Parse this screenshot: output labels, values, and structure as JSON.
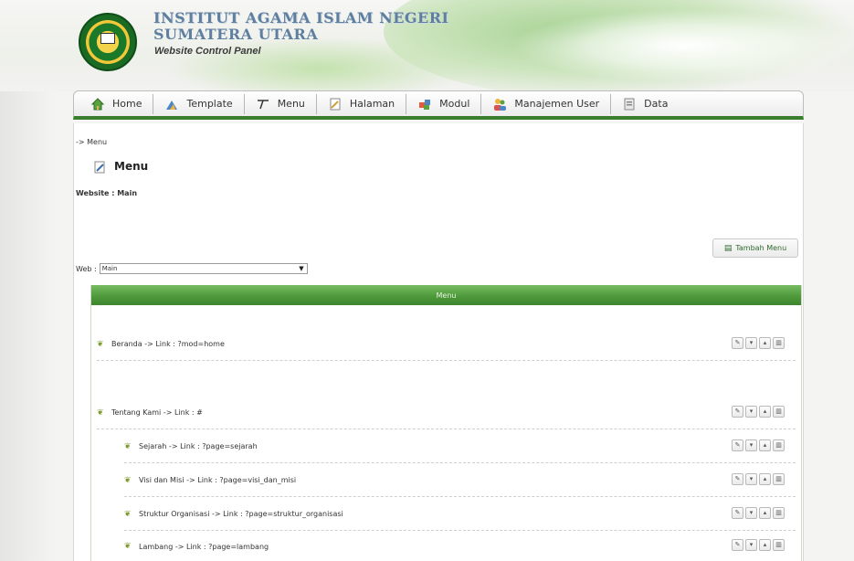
{
  "header": {
    "institution_line1": "INSTITUT AGAMA ISLAM NEGERI",
    "institution_line2": "SUMATERA UTARA",
    "panel_title": "Website Control Panel"
  },
  "nav": {
    "items": [
      {
        "label": "Home",
        "icon": "home-icon"
      },
      {
        "label": "Template",
        "icon": "template-icon"
      },
      {
        "label": "Menu",
        "icon": "menu-icon"
      },
      {
        "label": "Halaman",
        "icon": "page-icon"
      },
      {
        "label": "Modul",
        "icon": "module-icon"
      },
      {
        "label": "Manajemen User",
        "icon": "users-icon"
      },
      {
        "label": "Data",
        "icon": "data-icon"
      }
    ]
  },
  "content": {
    "breadcrumb": "-> Menu",
    "page_title": "Menu",
    "website_label": "Website : Main",
    "add_button_label": "Tambah Menu",
    "web_select_label": "Web :",
    "web_select_value": "Main",
    "table_header": "Menu",
    "rows": [
      {
        "text": "Beranda -> Link : ?mod=home",
        "level": 0
      },
      {
        "text": "Tentang Kami -> Link : #",
        "level": 0
      },
      {
        "text": "Sejarah -> Link : ?page=sejarah",
        "level": 1
      },
      {
        "text": "Visi dan Misi -> Link : ?page=visi_dan_misi",
        "level": 1
      },
      {
        "text": "Struktur Organisasi -> Link : ?page=struktur_organisasi",
        "level": 1
      },
      {
        "text": "Lambang -> Link : ?page=lambang",
        "level": 1
      }
    ],
    "row_actions": [
      "edit",
      "down",
      "up",
      "delete"
    ]
  },
  "colors": {
    "accent_green": "#3b7d2e",
    "header_blue": "#5e7fa0"
  }
}
